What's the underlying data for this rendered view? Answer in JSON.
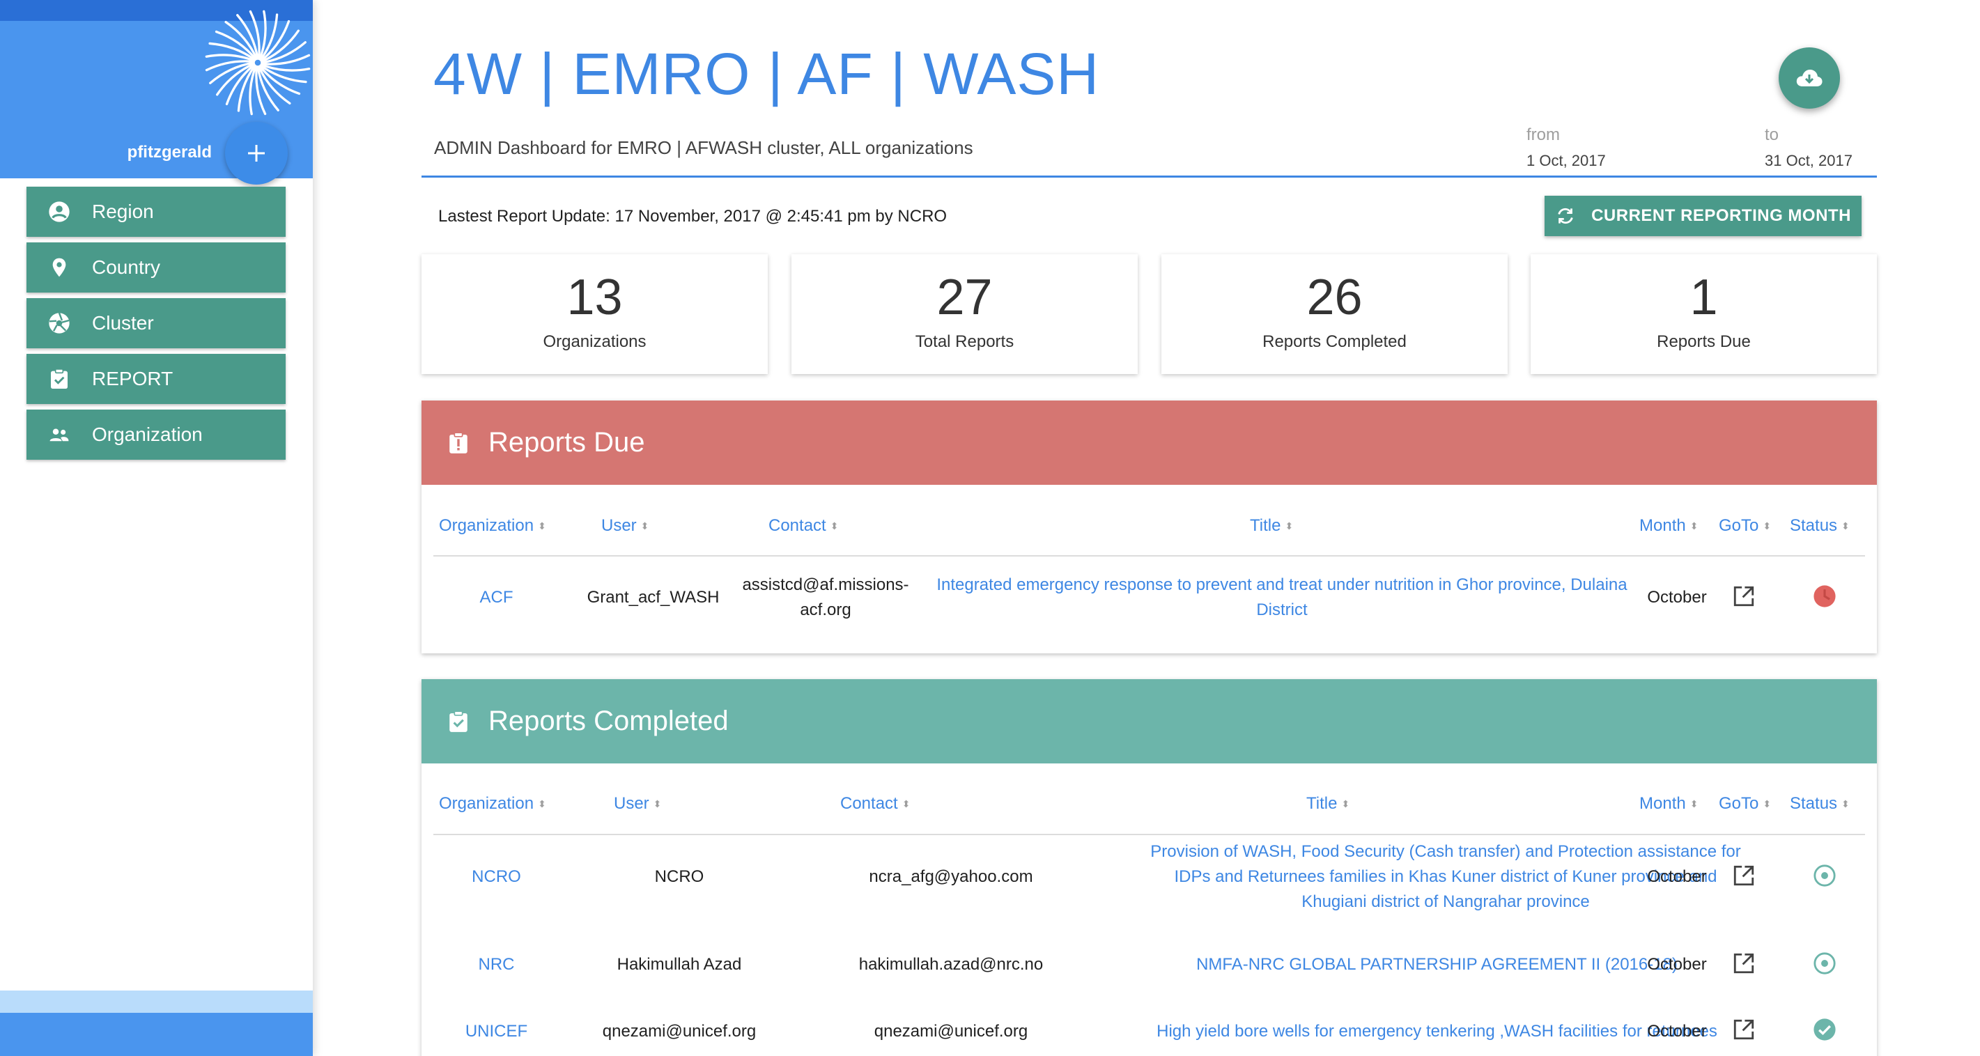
{
  "sidebar": {
    "username": "pfitzgerald",
    "items": [
      {
        "label": "Region",
        "icon": "account-circle-icon"
      },
      {
        "label": "Country",
        "icon": "location-pin-icon"
      },
      {
        "label": "Cluster",
        "icon": "aperture-icon"
      },
      {
        "label": "REPORT",
        "icon": "clipboard-check-icon"
      },
      {
        "label": "Organization",
        "icon": "people-icon"
      }
    ]
  },
  "header": {
    "title": "4W | EMRO | AF | WASH",
    "subtitle": "ADMIN Dashboard for EMRO | AFWASH cluster, ALL organizations",
    "from_label": "from",
    "from_value": "1 Oct, 2017",
    "to_label": "to",
    "to_value": "31 Oct, 2017",
    "last_update": "Lastest Report Update: 17 November, 2017 @ 2:45:41 pm by NCRO",
    "reporting_button": "CURRENT REPORTING MONTH"
  },
  "stats": [
    {
      "value": "13",
      "label": "Organizations"
    },
    {
      "value": "27",
      "label": "Total Reports"
    },
    {
      "value": "26",
      "label": "Reports Completed"
    },
    {
      "value": "1",
      "label": "Reports Due"
    }
  ],
  "reports_due": {
    "title": "Reports Due",
    "columns": [
      "Organization",
      "User",
      "Contact",
      "Title",
      "Month",
      "GoTo",
      "Status"
    ],
    "rows": [
      {
        "organization": "ACF",
        "user": "Grant_acf_WASH",
        "contact_1": "assistcd@af.missions-",
        "contact_2": "acf.org",
        "title_1": "Integrated emergency response to prevent and treat under nutrition in Ghor province, Dulaina",
        "title_2": "District",
        "month": "October",
        "status": "overdue-clock-icon"
      }
    ]
  },
  "reports_completed": {
    "title": "Reports Completed",
    "columns": [
      "Organization",
      "User",
      "Contact",
      "Title",
      "Month",
      "GoTo",
      "Status"
    ],
    "rows": [
      {
        "organization": "NCRO",
        "user": "NCRO",
        "contact": "ncra_afg@yahoo.com",
        "title_1": "Provision of WASH, Food Security (Cash transfer) and Protection assistance for",
        "title_2": "IDPs and Returnees families in Khas Kuner district of Kuner province and",
        "title_3": "Khugiani district of Nangrahar province",
        "month": "October",
        "status": "radio-pending-icon"
      },
      {
        "organization": "NRC",
        "user": "Hakimullah Azad",
        "contact": "hakimullah.azad@nrc.no",
        "title_1": "NMFA-NRC GLOBAL PARTNERSHIP AGREEMENT II (2016-18)",
        "month": "October",
        "status": "radio-pending-icon"
      },
      {
        "organization": "UNICEF",
        "user": "qnezami@unicef.org",
        "contact": "qnezami@unicef.org",
        "title_1": "High yield bore wells for emergency tenkering ,WASH facilities for returnees",
        "month": "October",
        "status": "check-circle-icon"
      }
    ]
  },
  "colors": {
    "primary_blue": "#3e87e3",
    "teal": "#4a9a8a",
    "due_red": "#d57672",
    "completed_teal": "#6cb5aa"
  }
}
